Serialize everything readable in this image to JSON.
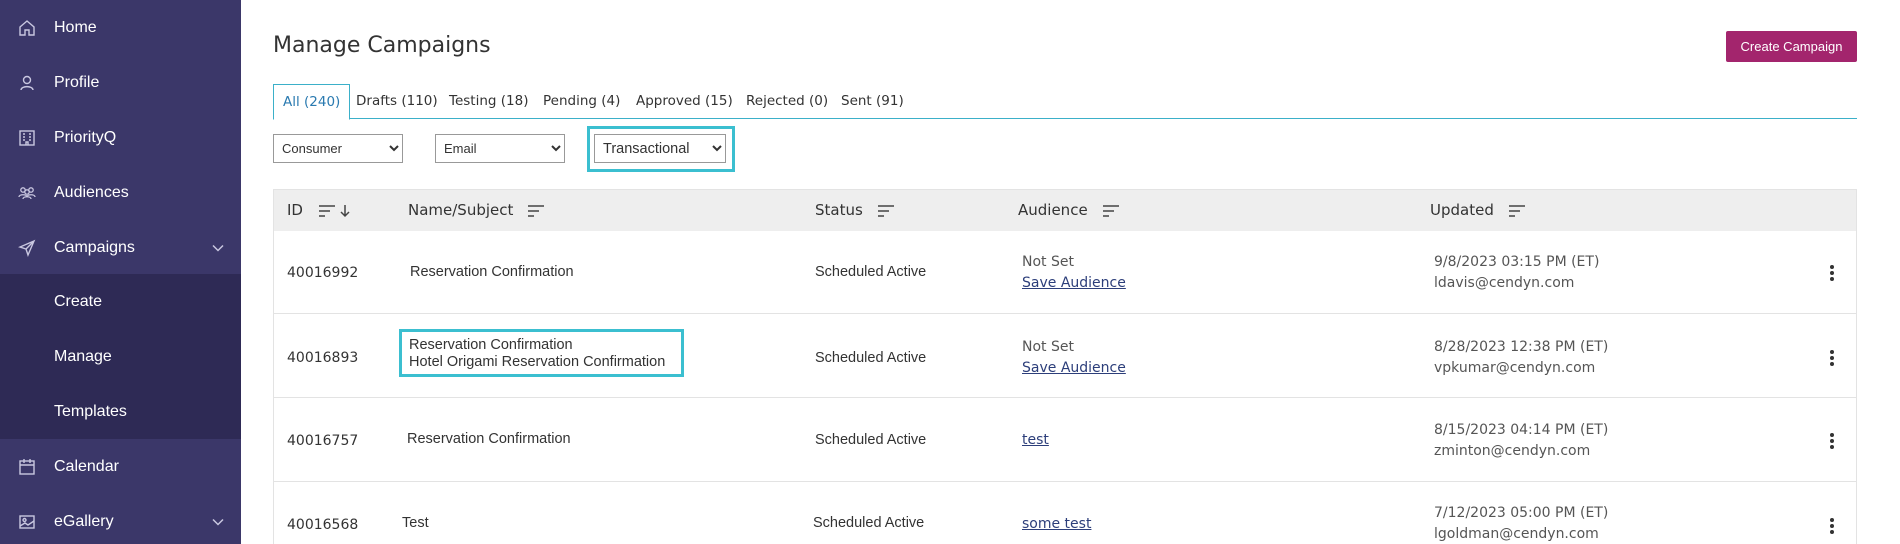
{
  "sidebar": {
    "items": [
      {
        "label": "Home",
        "icon": "home-icon"
      },
      {
        "label": "Profile",
        "icon": "user-icon"
      },
      {
        "label": "PriorityQ",
        "icon": "building-icon"
      },
      {
        "label": "Audiences",
        "icon": "people-icon"
      },
      {
        "label": "Campaigns",
        "icon": "send-icon"
      },
      {
        "label": "Calendar",
        "icon": "calendar-icon"
      },
      {
        "label": "eGallery",
        "icon": "image-icon"
      }
    ],
    "subitems": [
      {
        "label": "Create"
      },
      {
        "label": "Manage"
      },
      {
        "label": "Templates"
      }
    ],
    "bg_color": "#3b3769",
    "sub_bg_color": "#2e2a55"
  },
  "header": {
    "title": "Manage Campaigns",
    "create_button": "Create Campaign",
    "accent_color": "#a3256d"
  },
  "tabs": [
    {
      "label": "All (240)",
      "active": true
    },
    {
      "label": "Drafts (110)"
    },
    {
      "label": "Testing (18)"
    },
    {
      "label": "Pending (4)"
    },
    {
      "label": "Approved (15)"
    },
    {
      "label": "Rejected (0)"
    },
    {
      "label": "Sent (91)"
    }
  ],
  "filters": {
    "segment": {
      "selected": "Consumer",
      "options": [
        "Consumer"
      ]
    },
    "channel": {
      "selected": "Email",
      "options": [
        "Email"
      ]
    },
    "type": {
      "selected": "Transactional",
      "options": [
        "Transactional"
      ]
    }
  },
  "table": {
    "columns": {
      "id": "ID",
      "name": "Name/Subject",
      "status": "Status",
      "audience": "Audience",
      "updated": "Updated"
    },
    "rows": [
      {
        "id": "40016992",
        "name": "Reservation Confirmation",
        "subject": "",
        "status": "Scheduled Active",
        "audience_name": "Not Set",
        "audience_link": "Save Audience",
        "updated": "9/8/2023 03:15 PM (ET)",
        "user": "ldavis@cendyn.com"
      },
      {
        "id": "40016893",
        "name": "Reservation Confirmation",
        "subject": "Hotel Origami Reservation Confirmation",
        "status": "Scheduled Active",
        "audience_name": "Not Set",
        "audience_link": "Save Audience",
        "updated": "8/28/2023 12:38 PM (ET)",
        "user": "vpkumar@cendyn.com"
      },
      {
        "id": "40016757",
        "name": "Reservation Confirmation",
        "subject": "",
        "status": "Scheduled Active",
        "audience_name": "",
        "audience_link": "test",
        "updated": "8/15/2023 04:14 PM (ET)",
        "user": "zminton@cendyn.com"
      },
      {
        "id": "40016568",
        "name": "Test",
        "subject": "",
        "status": "Scheduled Active",
        "audience_name": "",
        "audience_link": "some test",
        "updated": "7/12/2023 05:00 PM (ET)",
        "user": "lgoldman@cendyn.com"
      }
    ]
  },
  "highlight_color": "#3bbfd0"
}
